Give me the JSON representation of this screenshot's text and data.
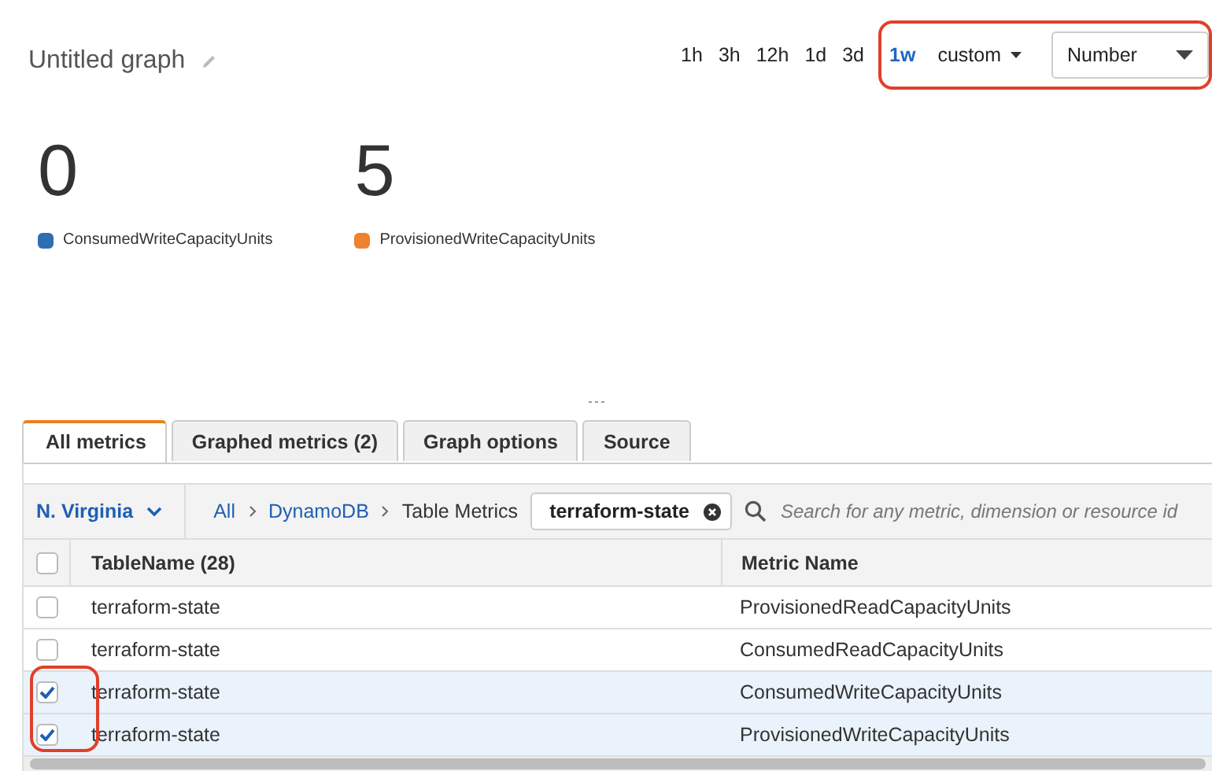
{
  "graph": {
    "title": "Untitled graph"
  },
  "time_ranges": [
    {
      "label": "1h",
      "selected": false
    },
    {
      "label": "3h",
      "selected": false
    },
    {
      "label": "12h",
      "selected": false
    },
    {
      "label": "1d",
      "selected": false
    },
    {
      "label": "3d",
      "selected": false
    },
    {
      "label": "1w",
      "selected": true
    }
  ],
  "custom": {
    "label": "custom"
  },
  "view_select": {
    "value": "Number"
  },
  "stats": [
    {
      "value": "0",
      "name": "ConsumedWriteCapacityUnits",
      "color": "#2f6db3"
    },
    {
      "value": "5",
      "name": "ProvisionedWriteCapacityUnits",
      "color": "#f0812f"
    }
  ],
  "tabs": [
    {
      "label": "All metrics",
      "selected": true
    },
    {
      "label": "Graphed metrics (2)",
      "selected": false
    },
    {
      "label": "Graph options",
      "selected": false
    },
    {
      "label": "Source",
      "selected": false
    }
  ],
  "region": {
    "label": "N. Virginia"
  },
  "breadcrumb": [
    {
      "label": "All",
      "kind": "link"
    },
    {
      "label": "DynamoDB",
      "kind": "link"
    },
    {
      "label": "Table Metrics",
      "kind": "current"
    }
  ],
  "filter_token": {
    "label": "terraform-state"
  },
  "search": {
    "placeholder": "Search for any metric, dimension or resource id"
  },
  "table": {
    "header_checked": false,
    "columns": [
      "TableName (28)",
      "Metric Name"
    ],
    "rows": [
      {
        "cells": [
          "terraform-state",
          "ProvisionedReadCapacityUnits"
        ],
        "checked": false
      },
      {
        "cells": [
          "terraform-state",
          "ConsumedReadCapacityUnits"
        ],
        "checked": false
      },
      {
        "cells": [
          "terraform-state",
          "ConsumedWriteCapacityUnits"
        ],
        "checked": true
      },
      {
        "cells": [
          "terraform-state",
          "ProvisionedWriteCapacityUnits"
        ],
        "checked": true
      }
    ]
  }
}
